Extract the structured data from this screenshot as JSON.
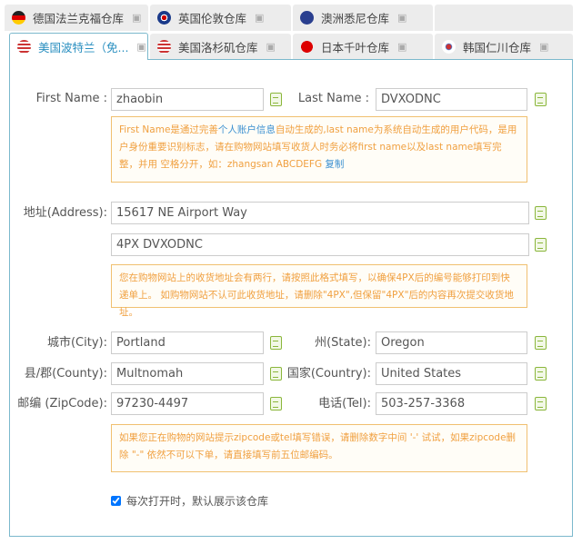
{
  "tabs": [
    {
      "label": "德国法兰克福仓库",
      "flag": "de"
    },
    {
      "label": "英国伦敦仓库",
      "flag": "uk"
    },
    {
      "label": "澳洲悉尼仓库",
      "flag": "au"
    },
    {
      "label": "美国波特兰（免...",
      "flag": "us",
      "active": true
    },
    {
      "label": "美国洛杉矶仓库",
      "flag": "us"
    },
    {
      "label": "日本千叶仓库",
      "flag": "jp"
    },
    {
      "label": "韩国仁川仓库",
      "flag": "kr"
    }
  ],
  "form": {
    "first_name_label": "First Name :",
    "first_name": "zhaobin",
    "last_name_label": "Last Name :",
    "last_name": "DVXODNC",
    "note1": {
      "a": "First Name是通过完善",
      "link": "个人账户信息",
      "b": "自动生成的,last name为系统自动生成的用户代码，是用户身份重要识别标志，请在购物网站填写收货人时务必将first name以及last name填写完整，并用 空格分开，如：zhangsan ABCDEFG ",
      "copy": "复制"
    },
    "address_label": "地址(Address):",
    "address1": "15617 NE Airport Way",
    "address2": "4PX DVXODNC",
    "note2": "您在购物网站上的收货地址会有两行，请按照此格式填写，以确保4PX后的编号能够打印到快递单上。 如购物网站不认可此收货地址，请删除\"4PX\",但保留\"4PX\"后的内容再次提交收货地址。",
    "city_label": "城市(City):",
    "city": "Portland",
    "state_label": "州(State):",
    "state": "Oregon",
    "county_label": "县/郡(County):",
    "county": "Multnomah",
    "country_label": "国家(Country):",
    "country": "United States",
    "zip_label": "邮编 (ZipCode):",
    "zip": "97230-4497",
    "tel_label": "电话(Tel):",
    "tel": "503-257-3368",
    "note3": "如果您正在购物的网站提示zipcode或tel填写错误，请删除数字中间 '-' 试试，如果zipcode删除 \"-\" 依然不可以下单，请直接填写前五位邮编码。",
    "default_label": "每次打开时，默认展示该仓库",
    "default_checked": true
  }
}
